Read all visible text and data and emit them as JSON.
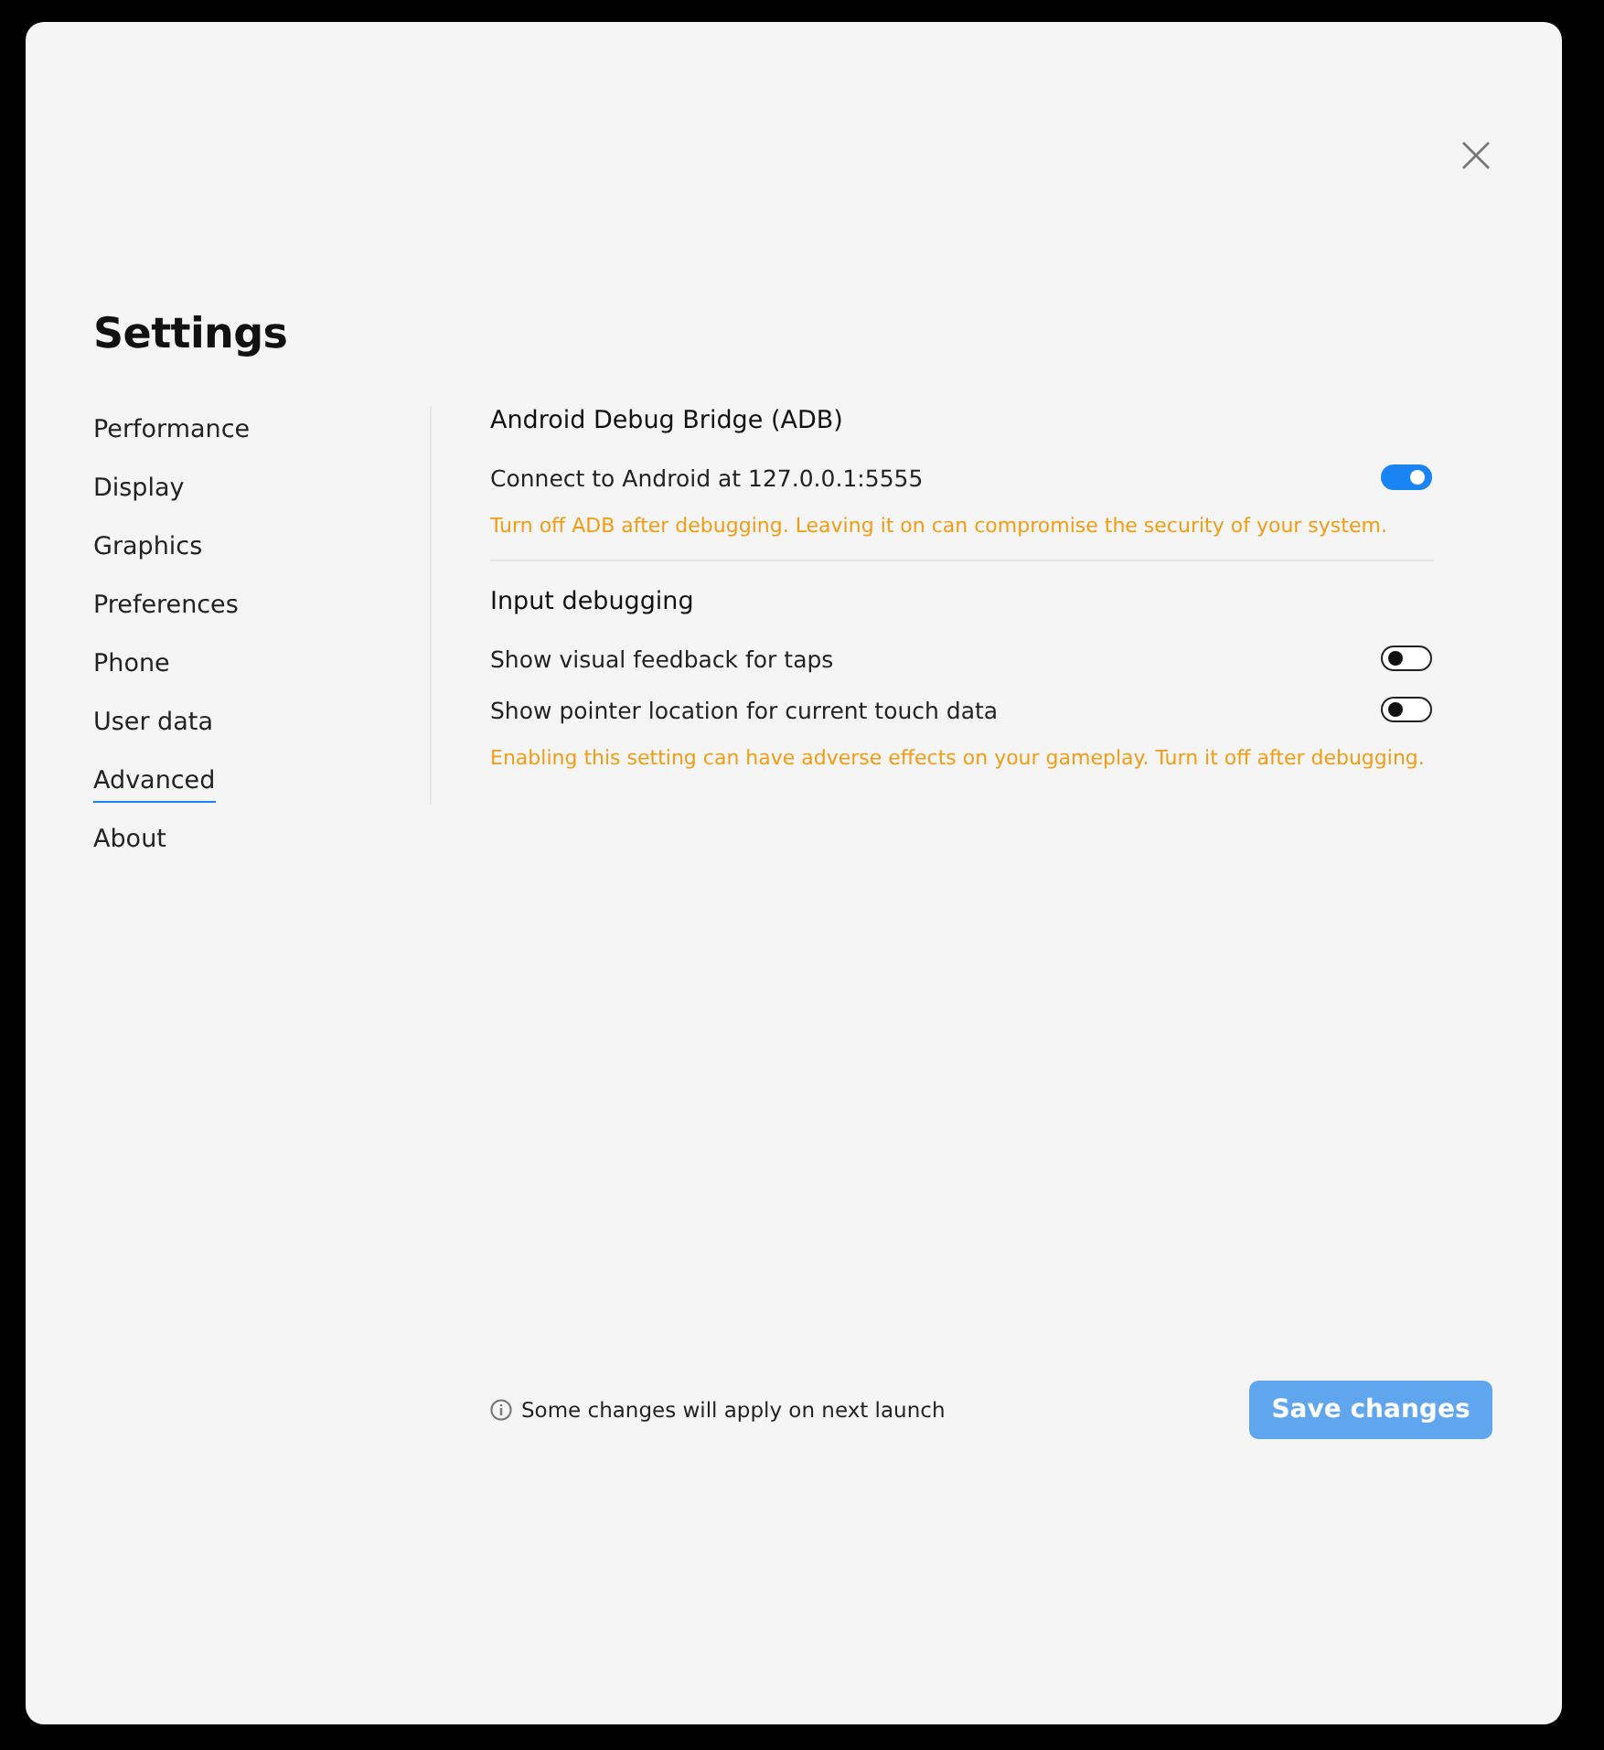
{
  "title": "Settings",
  "sidebar": {
    "items": [
      {
        "label": "Performance",
        "selected": false
      },
      {
        "label": "Display",
        "selected": false
      },
      {
        "label": "Graphics",
        "selected": false
      },
      {
        "label": "Preferences",
        "selected": false
      },
      {
        "label": "Phone",
        "selected": false
      },
      {
        "label": "User data",
        "selected": false
      },
      {
        "label": "Advanced",
        "selected": true
      },
      {
        "label": "About",
        "selected": false
      }
    ]
  },
  "sections": [
    {
      "title": "Android Debug Bridge (ADB)",
      "rows": [
        {
          "label": "Connect to Android at 127.0.0.1:5555",
          "on": true
        }
      ],
      "warning": "Turn off ADB after debugging. Leaving it on can compromise the security of your system."
    },
    {
      "title": "Input debugging",
      "rows": [
        {
          "label": "Show visual feedback for taps",
          "on": false
        },
        {
          "label": "Show pointer location for current touch data",
          "on": false
        }
      ],
      "warning": "Enabling this setting can have adverse effects on your gameplay. Turn it off after debugging."
    }
  ],
  "footer": {
    "note": "Some changes will apply on next launch",
    "save_button": {
      "label": "Save changes",
      "disabled": true
    }
  }
}
